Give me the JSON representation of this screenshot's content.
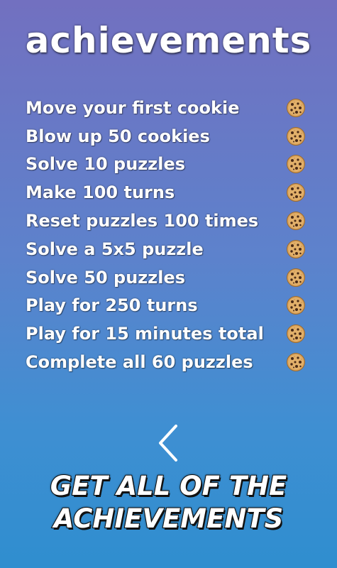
{
  "title": "achievements",
  "achievements": [
    {
      "label": "Move your first cookie",
      "icon": "cookie-icon"
    },
    {
      "label": "Blow up 50 cookies",
      "icon": "cookie-icon"
    },
    {
      "label": "Solve 10 puzzles",
      "icon": "cookie-icon"
    },
    {
      "label": "Make 100 turns",
      "icon": "cookie-icon"
    },
    {
      "label": "Reset puzzles 100 times",
      "icon": "cookie-icon"
    },
    {
      "label": "Solve a 5x5 puzzle",
      "icon": "cookie-icon"
    },
    {
      "label": "Solve 50 puzzles",
      "icon": "cookie-icon"
    },
    {
      "label": "Play for 250 turns",
      "icon": "cookie-icon"
    },
    {
      "label": "Play for 15 minutes total",
      "icon": "cookie-icon"
    },
    {
      "label": "Complete all 60 puzzles",
      "icon": "cookie-icon"
    }
  ],
  "back_icon": "chevron-left-icon",
  "banner": {
    "line1": "GET ALL OF THE",
    "line2": "ACHIEVEMENTS"
  },
  "colors": {
    "background_top": "#7270c0",
    "background_bottom": "#2f8ecf",
    "text": "#ffffff",
    "cookie": "#d9a25a"
  }
}
